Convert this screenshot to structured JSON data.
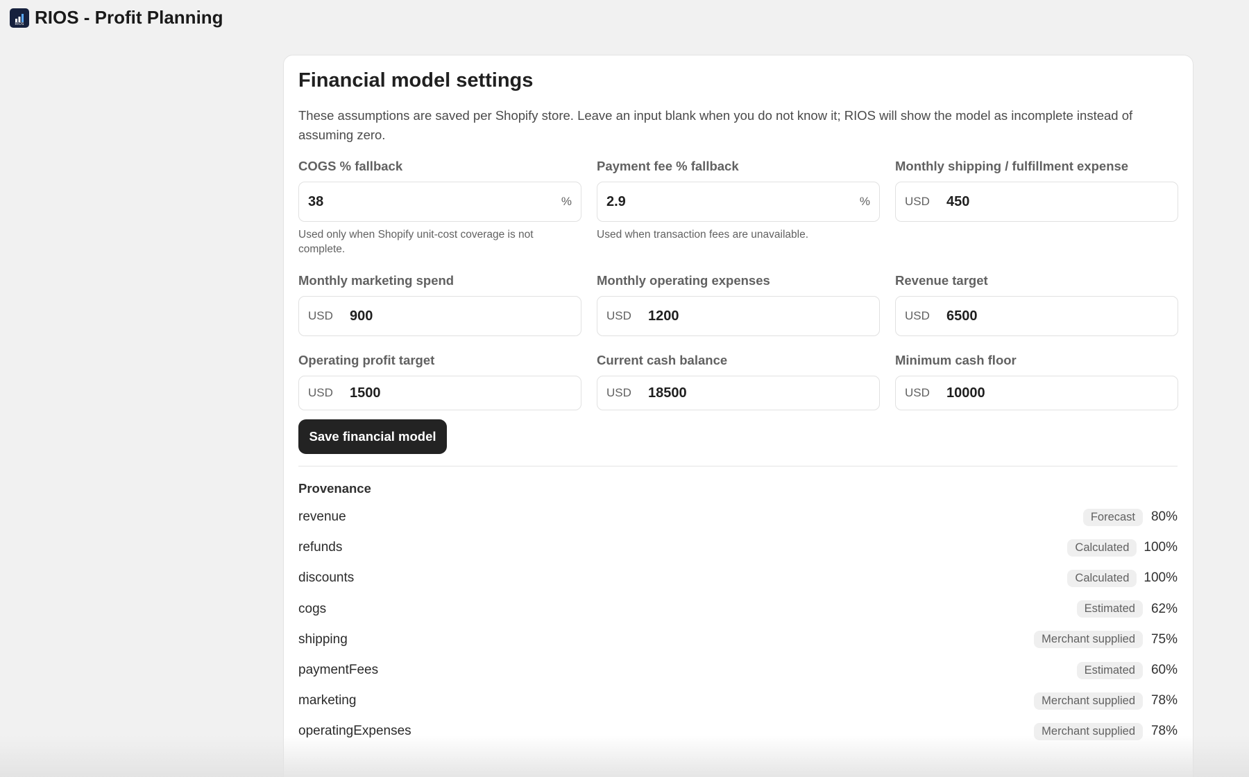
{
  "app": {
    "title": "RIOS - Profit Planning",
    "logo_text": "RIOS"
  },
  "card": {
    "title": "Financial model settings",
    "description": "These assumptions are saved per Shopify store. Leave an input blank when you do not know it; RIOS will show the model as incomplete instead of assuming zero."
  },
  "fields": {
    "cogs": {
      "label": "COGS % fallback",
      "value": "38",
      "suffix": "%",
      "help": "Used only when Shopify unit-cost coverage is not complete."
    },
    "payment_fee": {
      "label": "Payment fee % fallback",
      "value": "2.9",
      "suffix": "%",
      "help": "Used when transaction fees are unavailable."
    },
    "shipping": {
      "label": "Monthly shipping / fulfillment expense",
      "prefix": "USD",
      "value": "450"
    },
    "marketing": {
      "label": "Monthly marketing spend",
      "prefix": "USD",
      "value": "900"
    },
    "operating": {
      "label": "Monthly operating expenses",
      "prefix": "USD",
      "value": "1200"
    },
    "revenue_target": {
      "label": "Revenue target",
      "prefix": "USD",
      "value": "6500"
    },
    "profit_target": {
      "label": "Operating profit target",
      "prefix": "USD",
      "value": "1500"
    },
    "cash_balance": {
      "label": "Current cash balance",
      "prefix": "USD",
      "value": "18500"
    },
    "cash_floor": {
      "label": "Minimum cash floor",
      "prefix": "USD",
      "value": "10000"
    }
  },
  "save_button": "Save financial model",
  "provenance": {
    "title": "Provenance",
    "rows": [
      {
        "name": "revenue",
        "badge": "Forecast",
        "percent": "80%"
      },
      {
        "name": "refunds",
        "badge": "Calculated",
        "percent": "100%"
      },
      {
        "name": "discounts",
        "badge": "Calculated",
        "percent": "100%"
      },
      {
        "name": "cogs",
        "badge": "Estimated",
        "percent": "62%"
      },
      {
        "name": "shipping",
        "badge": "Merchant supplied",
        "percent": "75%"
      },
      {
        "name": "paymentFees",
        "badge": "Estimated",
        "percent": "60%"
      },
      {
        "name": "marketing",
        "badge": "Merchant supplied",
        "percent": "78%"
      },
      {
        "name": "operatingExpenses",
        "badge": "Merchant supplied",
        "percent": "78%"
      }
    ]
  },
  "colors": {
    "accent": "#232323",
    "background": "#f1f1f1",
    "logo_bg": "#16213e"
  }
}
